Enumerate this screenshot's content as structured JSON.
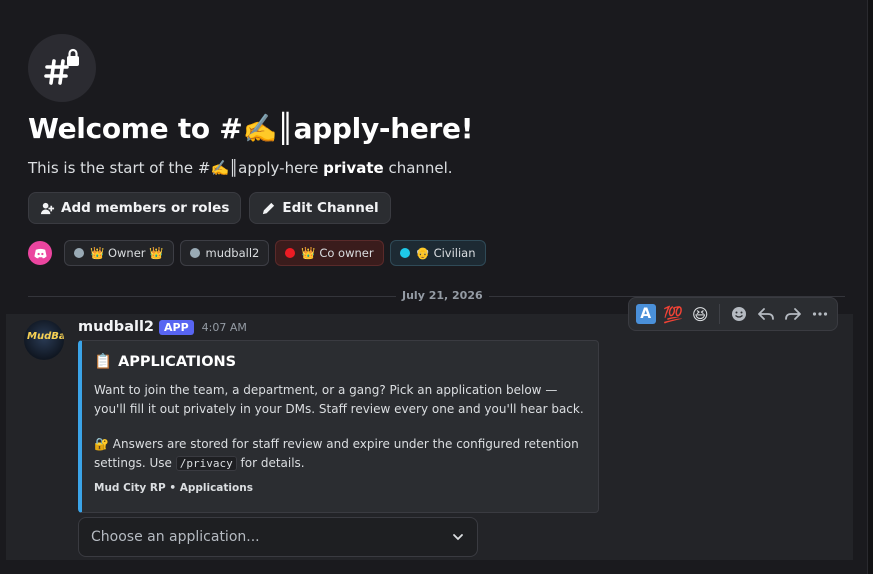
{
  "header": {
    "welcome_title": "Welcome to #✍️║apply-here!",
    "subtitle_prefix": "This is the start of the #✍️║apply-here ",
    "subtitle_bold": "private",
    "subtitle_suffix": " channel."
  },
  "actions": {
    "add_members_label": "Add members or roles",
    "edit_channel_label": "Edit Channel"
  },
  "roles": [
    {
      "label": "👑 Owner 👑",
      "color": "#99aab5"
    },
    {
      "label": "mudball2",
      "color": "#99aab5"
    },
    {
      "label": "👑 Co owner",
      "color": "#ed1c24"
    },
    {
      "label": "👴 Civilian",
      "color": "#1ec8e8"
    }
  ],
  "divider": {
    "date": "July 21, 2026"
  },
  "message": {
    "author": "mudball2",
    "tag": "APP",
    "time": "4:07 AM",
    "avatar_text": "MudBall",
    "embed": {
      "color": "#3ba4e8",
      "title_icon": "📋",
      "title": "APPLICATIONS",
      "description": "Want to join the team, a department, or a gang? Pick an application below — you'll fill it out privately in your DMs. Staff review every one and you'll hear back.",
      "privacy_icon": "🔐",
      "privacy_text_before": " Answers are stored for staff review and expire under the configured retention settings. Use ",
      "privacy_code": "/privacy",
      "privacy_text_after": " for details.",
      "footer": "Mud City RP • Applications"
    },
    "select_placeholder": "Choose an application..."
  },
  "hover_bar": {
    "reaction_1": "A",
    "reaction_2": "💯",
    "reaction_3": "😆",
    "icons": [
      "add-reaction-icon",
      "reply-icon",
      "forward-icon",
      "more-icon"
    ]
  }
}
